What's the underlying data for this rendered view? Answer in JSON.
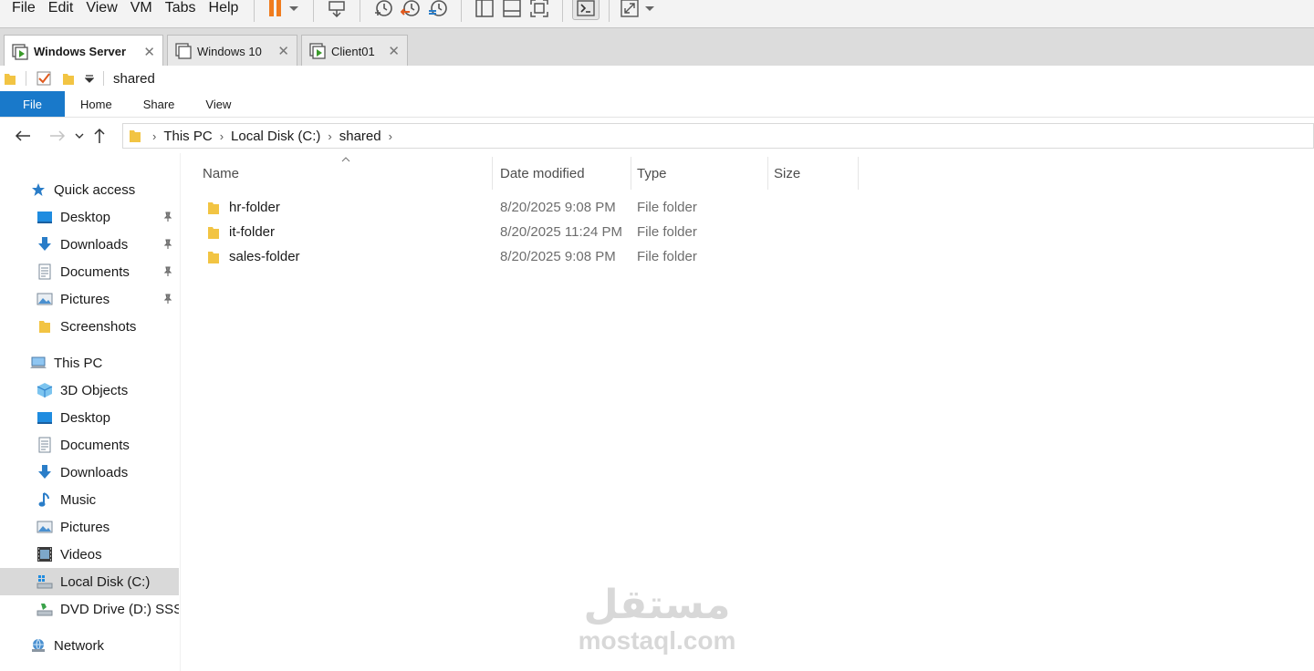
{
  "vmware": {
    "menu": [
      "File",
      "Edit",
      "View",
      "VM",
      "Tabs",
      "Help"
    ],
    "tabs": [
      {
        "label": "Windows Server",
        "active": true
      },
      {
        "label": "Windows 10",
        "active": false
      },
      {
        "label": "Client01",
        "active": false
      }
    ],
    "tab_close_glyph": "✕"
  },
  "explorer": {
    "window_title": "shared",
    "ribbon": {
      "file": "File",
      "tabs": [
        "Home",
        "Share",
        "View"
      ]
    },
    "address": {
      "crumbs": [
        "This PC",
        "Local Disk (C:)",
        "shared"
      ]
    },
    "sidebar": {
      "quick_access": {
        "label": "Quick access",
        "items": [
          {
            "label": "Desktop",
            "icon": "desktop-icon",
            "pinned": true
          },
          {
            "label": "Downloads",
            "icon": "downloads-icon",
            "pinned": true
          },
          {
            "label": "Documents",
            "icon": "documents-icon",
            "pinned": true
          },
          {
            "label": "Pictures",
            "icon": "pictures-icon",
            "pinned": true
          },
          {
            "label": "Screenshots",
            "icon": "folder-icon",
            "pinned": false
          }
        ]
      },
      "this_pc": {
        "label": "This PC",
        "items": [
          {
            "label": "3D Objects",
            "icon": "3d-objects-icon"
          },
          {
            "label": "Desktop",
            "icon": "desktop-icon"
          },
          {
            "label": "Documents",
            "icon": "documents-icon"
          },
          {
            "label": "Downloads",
            "icon": "downloads-icon"
          },
          {
            "label": "Music",
            "icon": "music-icon"
          },
          {
            "label": "Pictures",
            "icon": "pictures-icon"
          },
          {
            "label": "Videos",
            "icon": "videos-icon"
          },
          {
            "label": "Local Disk (C:)",
            "icon": "local-disk-icon",
            "selected": true
          },
          {
            "label": "DVD Drive (D:) SSS_",
            "icon": "dvd-drive-icon"
          }
        ]
      },
      "network": {
        "label": "Network"
      }
    },
    "columns": [
      "Name",
      "Date modified",
      "Type",
      "Size"
    ],
    "files": [
      {
        "name": "hr-folder",
        "date": "8/20/2025 9:08 PM",
        "type": "File folder"
      },
      {
        "name": "it-folder",
        "date": "8/20/2025 11:24 PM",
        "type": "File folder"
      },
      {
        "name": "sales-folder",
        "date": "8/20/2025 9:08 PM",
        "type": "File folder"
      }
    ]
  },
  "watermark": {
    "arabic": "مستقل",
    "latin": "mostaql.com"
  },
  "colors": {
    "accent": "#1979ca",
    "folder": "#f2c443",
    "selected_row": "#d9d9d9",
    "pause_orange": "#f07c1e"
  }
}
